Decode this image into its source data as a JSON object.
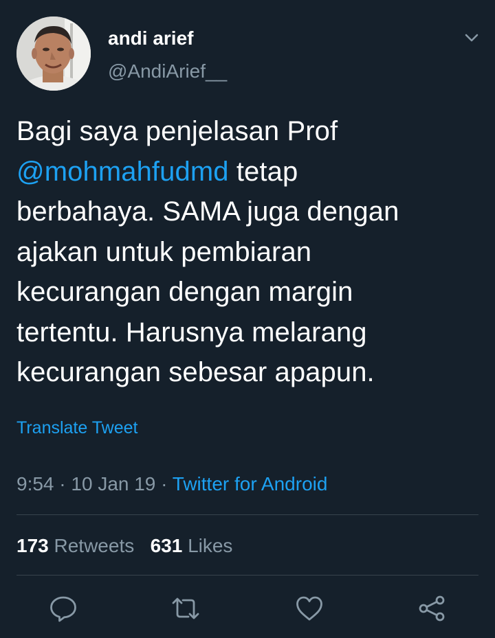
{
  "author": {
    "display_name": "andi arief",
    "handle": "@AndiArief__",
    "avatar_icon": "user-avatar-photo"
  },
  "tweet": {
    "text_before": "Bagi saya penjelasan Prof\n",
    "mention": "@mohmahfudmd",
    "text_after": " tetap\nberbahaya. SAMA juga dengan\najakan untuk pembiaran\nkecurangan dengan margin\ntertentu. Harusnya melarang\nkecurangan sebesar apapun.",
    "translate_label": "Translate Tweet"
  },
  "meta": {
    "time": "9:54",
    "sep1": " · ",
    "date": "10 Jan 19",
    "sep2": " · ",
    "source": "Twitter for Android"
  },
  "stats": {
    "retweets_count": "173",
    "retweets_label": "Retweets",
    "likes_count": "631",
    "likes_label": "Likes"
  },
  "actions": {
    "reply_icon": "reply-icon",
    "retweet_icon": "retweet-icon",
    "like_icon": "heart-icon",
    "share_icon": "share-icon"
  },
  "colors": {
    "background": "#15202b",
    "text": "#ffffff",
    "secondary": "#8899a6",
    "accent": "#1da1f2",
    "divider": "#38444d"
  }
}
